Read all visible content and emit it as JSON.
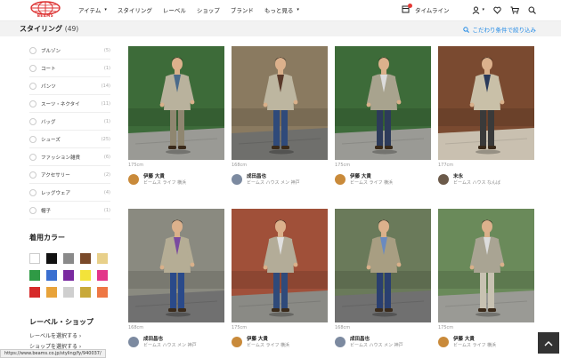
{
  "header": {
    "logo_text": "BEAMS",
    "nav": [
      {
        "label": "アイテム",
        "caret": "▾"
      },
      {
        "label": "スタイリング",
        "caret": ""
      },
      {
        "label": "レーベル",
        "caret": ""
      },
      {
        "label": "ショップ",
        "caret": ""
      },
      {
        "label": "ブランド",
        "caret": ""
      },
      {
        "label": "もっと見る",
        "caret": "▾"
      }
    ],
    "timeline_label": "タイムライン"
  },
  "subbar": {
    "title": "スタイリング",
    "count": "(49)",
    "refine_label": "こだわり条件で絞り込み"
  },
  "sidebar": {
    "categories": [
      {
        "label": "ブルゾン",
        "count": "(5)"
      },
      {
        "label": "コート",
        "count": "(1)"
      },
      {
        "label": "パンツ",
        "count": "(14)"
      },
      {
        "label": "スーツ・ネクタイ",
        "count": "(11)"
      },
      {
        "label": "バッグ",
        "count": "(1)"
      },
      {
        "label": "シューズ",
        "count": "(25)"
      },
      {
        "label": "ファッション雑貨",
        "count": "(6)"
      },
      {
        "label": "アクセサリー",
        "count": "(2)"
      },
      {
        "label": "レッグウェア",
        "count": "(4)"
      },
      {
        "label": "帽子",
        "count": "(1)"
      }
    ],
    "color_title": "着用カラー",
    "colors": [
      "#ffffff",
      "#111111",
      "#8a8a8a",
      "#7a4a2a",
      "#e8d08a",
      "#2f9a45",
      "#3a6fd0",
      "#7a2aa0",
      "#f3e33a",
      "#e3368a",
      "#d62a2a",
      "#e8a33a",
      "#cfcfcf",
      "#c8a93a",
      "#ee7744"
    ],
    "label_shop_title": "レーベル・ショップ",
    "label_select": "レーベルを選択する",
    "shop_select": "ショップを選択する"
  },
  "status_url": "https://www.beams.co.jp/styling/fy/940037/",
  "cards": [
    {
      "height": "175cm",
      "name": "伊藤 大貴",
      "shop": "ビームス ライフ 横浜",
      "avatar": "#c98a3a",
      "bg": "#3d6b3a",
      "jacket": "#b9b29d",
      "pants": "#8f8670",
      "inner": "#4a6a8a",
      "floor": "#9a9a95"
    },
    {
      "height": "168cm",
      "name": "成田昌也",
      "shop": "ビームス ハウス メン 神戸",
      "avatar": "#7c8aa0",
      "bg": "#8a7a60",
      "jacket": "#bdb6a0",
      "pants": "#2f4a7a",
      "inner": "#5a3a2a",
      "floor": "#6f6f6c"
    },
    {
      "height": "175cm",
      "name": "伊藤 大貴",
      "shop": "ビームス ライフ 横浜",
      "avatar": "#c98a3a",
      "bg": "#3d6b3a",
      "jacket": "#a8a38e",
      "pants": "#2d3b5a",
      "inner": "#dcdcdc",
      "floor": "#9a9a95"
    },
    {
      "height": "177cm",
      "name": "末永",
      "shop": "ビームス ハウス なんば",
      "avatar": "#6b5a4a",
      "bg": "#7a4a30",
      "jacket": "#c9c0a8",
      "pants": "#3a3a3a",
      "inner": "#2a3a5a",
      "floor": "#c9c0b0"
    },
    {
      "height": "168cm",
      "name": "成田昌也",
      "shop": "ビームス ハウス メン 神戸",
      "avatar": "#7c8aa0",
      "bg": "#8a8a80",
      "jacket": "#b5ad95",
      "pants": "#2a4a8a",
      "inner": "#7a4aa0",
      "floor": "#707070"
    },
    {
      "height": "175cm",
      "name": "伊藤 大貴",
      "shop": "ビームス ライフ 横浜",
      "avatar": "#c98a3a",
      "bg": "#a0503a",
      "jacket": "#b3ac98",
      "pants": "#2f4a7a",
      "inner": "#e0e0e0",
      "floor": "#8a8a85"
    },
    {
      "height": "168cm",
      "name": "成田昌也",
      "shop": "ビームス ハウス メン 神戸",
      "avatar": "#7c8aa0",
      "bg": "#6a7a5a",
      "jacket": "#a89e82",
      "pants": "#2a3f70",
      "inner": "#6a8ac0",
      "floor": "#707070"
    },
    {
      "height": "175cm",
      "name": "伊藤 大貴",
      "shop": "ビームス ライフ 横浜",
      "avatar": "#c98a3a",
      "bg": "#6a8a5a",
      "jacket": "#a9a493",
      "pants": "#c8c2b2",
      "inner": "#dcdcdc",
      "floor": "#9a9a95"
    }
  ]
}
